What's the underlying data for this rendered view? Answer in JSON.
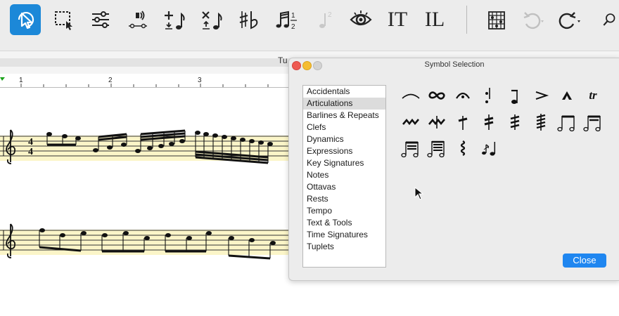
{
  "toolbar": {
    "items": [
      {
        "name": "select-tool-icon"
      },
      {
        "name": "marquee-select-icon"
      },
      {
        "name": "mixer-sliders-icon"
      },
      {
        "name": "audio-playback-icon"
      },
      {
        "name": "add-note-icon"
      },
      {
        "name": "delete-note-icon"
      },
      {
        "name": "accidentals-icon"
      },
      {
        "name": "tuplet-icon"
      },
      {
        "name": "disabled-tuplet-icon"
      },
      {
        "name": "view-eye-icon"
      },
      {
        "name": "text-tool-icon"
      },
      {
        "name": "lyrics-tool-icon"
      },
      {
        "name": "chord-grid-icon"
      },
      {
        "name": "undo-icon"
      },
      {
        "name": "redo-icon"
      },
      {
        "name": "search-icon"
      }
    ],
    "text_tool": "IT",
    "lyrics_tool": "IL"
  },
  "document": {
    "title_fragment": "Tu",
    "ruler_marks": [
      "1",
      "2",
      "3"
    ],
    "time_signature": {
      "top": "4",
      "bottom": "4"
    }
  },
  "dialog": {
    "title": "Symbol Selection",
    "categories": [
      "Accidentals",
      "Articulations",
      "Barlines & Repeats",
      "Clefs",
      "Dynamics",
      "Expressions",
      "Key Signatures",
      "Notes",
      "Ottavas",
      "Rests",
      "Tempo",
      "Text & Tools",
      "Time Signatures",
      "Tuplets"
    ],
    "selected_category": "Articulations",
    "symbols": [
      "slur",
      "turn",
      "fermata",
      "staccato",
      "tenuto",
      "accent",
      "marcato",
      "trill",
      "mordent",
      "inverted-mordent",
      "single-tremolo",
      "double-tremolo",
      "triple-tremolo",
      "quadruple-tremolo",
      "two-note-tremolo-one",
      "two-note-tremolo-two",
      "two-note-tremolo-three",
      "two-note-tremolo-four",
      "arpeggio",
      "grace-notes"
    ],
    "trill_label": "tr",
    "close_label": "Close"
  }
}
